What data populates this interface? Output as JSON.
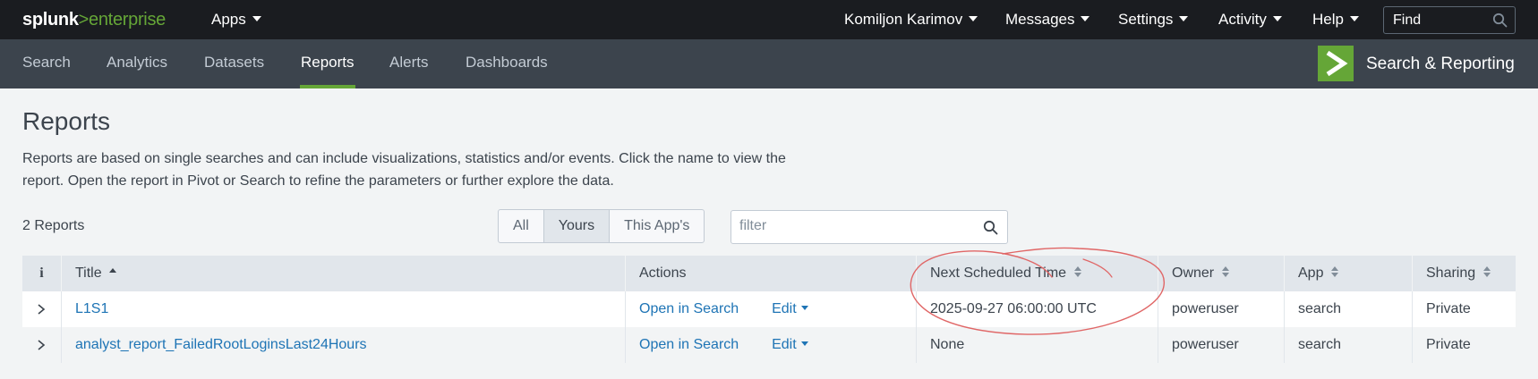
{
  "brand": {
    "primary": "splunk",
    "secondary": ">enterprise"
  },
  "topnav": {
    "apps": "Apps",
    "user": "Komiljon Karimov",
    "messages": "Messages",
    "settings": "Settings",
    "activity": "Activity",
    "help": "Help",
    "find_placeholder": "Find"
  },
  "appnav": {
    "tabs": [
      "Search",
      "Analytics",
      "Datasets",
      "Reports",
      "Alerts",
      "Dashboards"
    ],
    "active": "Reports",
    "app_title": "Search & Reporting"
  },
  "main": {
    "title": "Reports",
    "description": "Reports are based on single searches and can include visualizations, statistics and/or events. Click the name to view the report. Open the report in Pivot or Search to refine the parameters or further explore the data.",
    "count": "2 Reports",
    "segments": [
      "All",
      "Yours",
      "This App's"
    ],
    "selected_segment": "Yours",
    "filter_placeholder": "filter"
  },
  "table": {
    "headers": {
      "info": "i",
      "title": "Title",
      "actions": "Actions",
      "next_scheduled": "Next Scheduled Time",
      "owner": "Owner",
      "app": "App",
      "sharing": "Sharing"
    },
    "rows": [
      {
        "title": "L1S1",
        "open": "Open in Search",
        "edit": "Edit",
        "next_scheduled": "2025-09-27 06:00:00 UTC",
        "owner": "poweruser",
        "app": "search",
        "sharing": "Private"
      },
      {
        "title": "analyst_report_FailedRootLoginsLast24Hours",
        "open": "Open in Search",
        "edit": "Edit",
        "next_scheduled": "None",
        "owner": "poweruser",
        "app": "search",
        "sharing": "Private"
      }
    ]
  },
  "colors": {
    "topbar": "#1a1c20",
    "appbar": "#3c444d",
    "accent": "#65a637",
    "link": "#1e74b5",
    "annotation": "#e06666"
  }
}
